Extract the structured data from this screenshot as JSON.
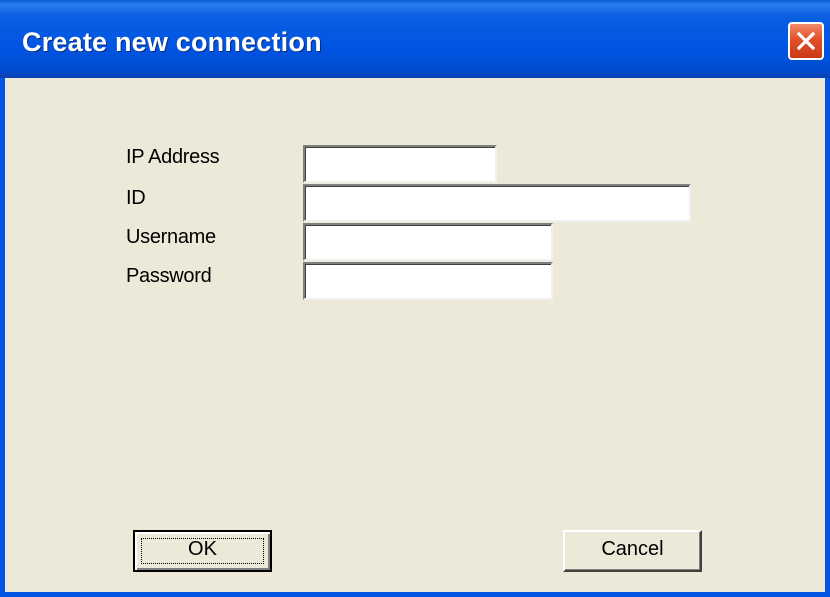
{
  "window": {
    "title": "Create new connection"
  },
  "form": {
    "ip_label": "IP Address",
    "ip_value": "",
    "id_label": "ID",
    "id_value": "",
    "username_label": "Username",
    "username_value": "",
    "password_label": "Password",
    "password_value": ""
  },
  "buttons": {
    "ok_label": "OK",
    "cancel_label": "Cancel"
  },
  "icons": {
    "close": "close-icon"
  },
  "colors": {
    "titlebar": "#0055e5",
    "close_button": "#e2502a",
    "dialog_background": "#ece9d8"
  }
}
